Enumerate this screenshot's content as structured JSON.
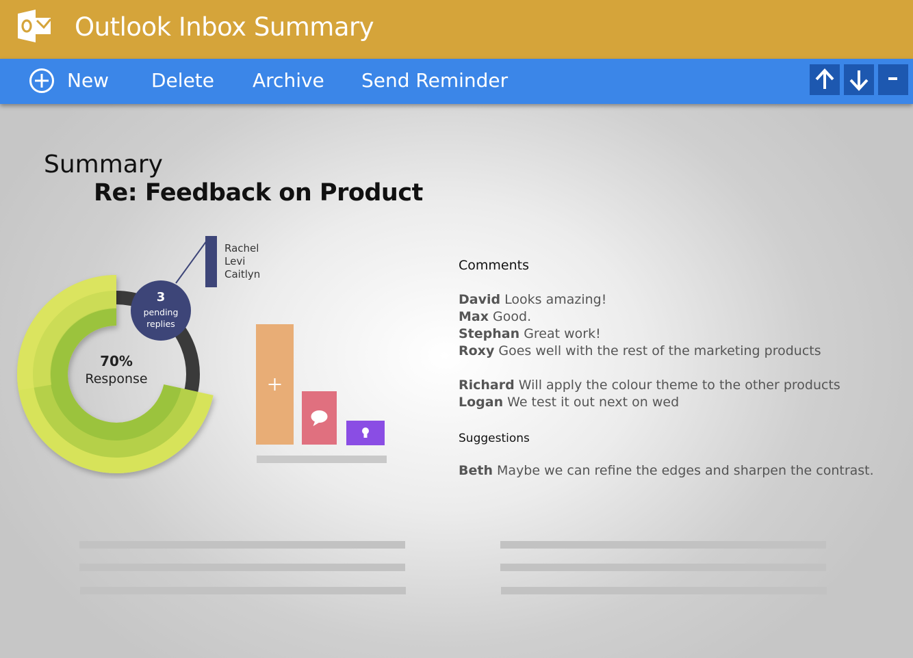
{
  "window": {
    "title": "Outlook Inbox Summary",
    "logo": "outlook-logo"
  },
  "toolbar": {
    "new_label": "New",
    "delete_label": "Delete",
    "archive_label": "Archive",
    "reminder_label": "Send Reminder",
    "icons": [
      "plus-circle-icon",
      "arrow-up-icon",
      "arrow-down-icon",
      "minimize-icon"
    ]
  },
  "summary": {
    "heading": "Summary",
    "subject": "Re: Feedback on Product"
  },
  "response_chart": {
    "percent_label": "70%",
    "response_label": "Response",
    "response_fraction": 0.7,
    "pending_count": "3",
    "pending_line1": "pending",
    "pending_line2": "replies",
    "pending_names": [
      "Rachel",
      "Levi",
      "Caitlyn"
    ],
    "colors": {
      "outer": "#d7e35a",
      "inner": "#9bc33c",
      "track": "#3a3a3a",
      "badge": "#3d4578"
    }
  },
  "activity_bars": {
    "values": [
      176,
      78,
      36
    ],
    "icons": [
      "plus-icon",
      "speech-bubble-icon",
      "lightbulb-icon"
    ],
    "colors": [
      "#e8ad76",
      "#e0707f",
      "#8a4de4"
    ]
  },
  "comments": {
    "heading": "Comments",
    "items": [
      {
        "name": "David",
        "text": "Looks amazing!"
      },
      {
        "name": "Max",
        "text": "Good."
      },
      {
        "name": "Stephan",
        "text": "Great work!"
      },
      {
        "name": "Roxy",
        "text": "Goes well with the rest of the marketing products"
      },
      {
        "name": "Richard",
        "text": "Will apply the colour theme to the other products"
      },
      {
        "name": "Logan",
        "text": "We test it out next on wed"
      }
    ]
  },
  "suggestions": {
    "heading": "Suggestions",
    "items": [
      {
        "name": "Beth",
        "text": "Maybe we can refine the edges and sharpen the contrast."
      }
    ]
  },
  "colors": {
    "titlebar": "#d5a43a",
    "toolbar": "#3b86e8",
    "nav_button": "#1d58b0"
  }
}
